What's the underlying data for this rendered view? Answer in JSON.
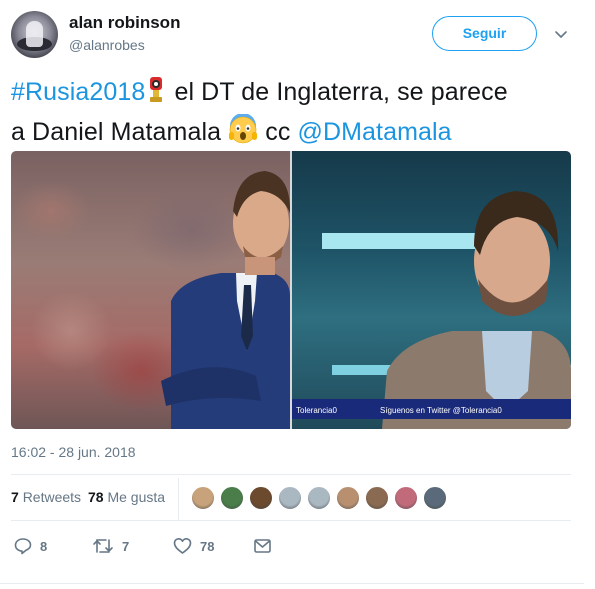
{
  "author": {
    "display_name": "alan robinson",
    "handle": "@alanrobes"
  },
  "follow_button": {
    "label": "Seguir"
  },
  "tweet": {
    "hashtag": "#Rusia2018",
    "text_part1": " el DT de Inglaterra, se parece",
    "text_part2": "a Daniel Matamala ",
    "text_part3": " cc ",
    "mention": "@DMatamala"
  },
  "media": {
    "right_ticker_left": "Tolerancia0",
    "right_ticker_right": "Síguenos en Twitter @Tolerancia0"
  },
  "timestamp": "16:02 - 28 jun. 2018",
  "stats": {
    "retweets_count": "7",
    "retweets_label": "Retweets",
    "likes_count": "78",
    "likes_label": "Me gusta",
    "likers": [
      "#c8a27a",
      "#4a7d4a",
      "#6b4a2e",
      "#aab8c2",
      "#aab8c2",
      "#b89070",
      "#8a6a50",
      "#c06a7a",
      "#5a6a7a"
    ]
  },
  "actions": {
    "replies": "8",
    "retweets": "7",
    "likes": "78"
  },
  "colors": {
    "accent": "#1da1f2",
    "link": "#1b95e0",
    "muted": "#657786"
  }
}
